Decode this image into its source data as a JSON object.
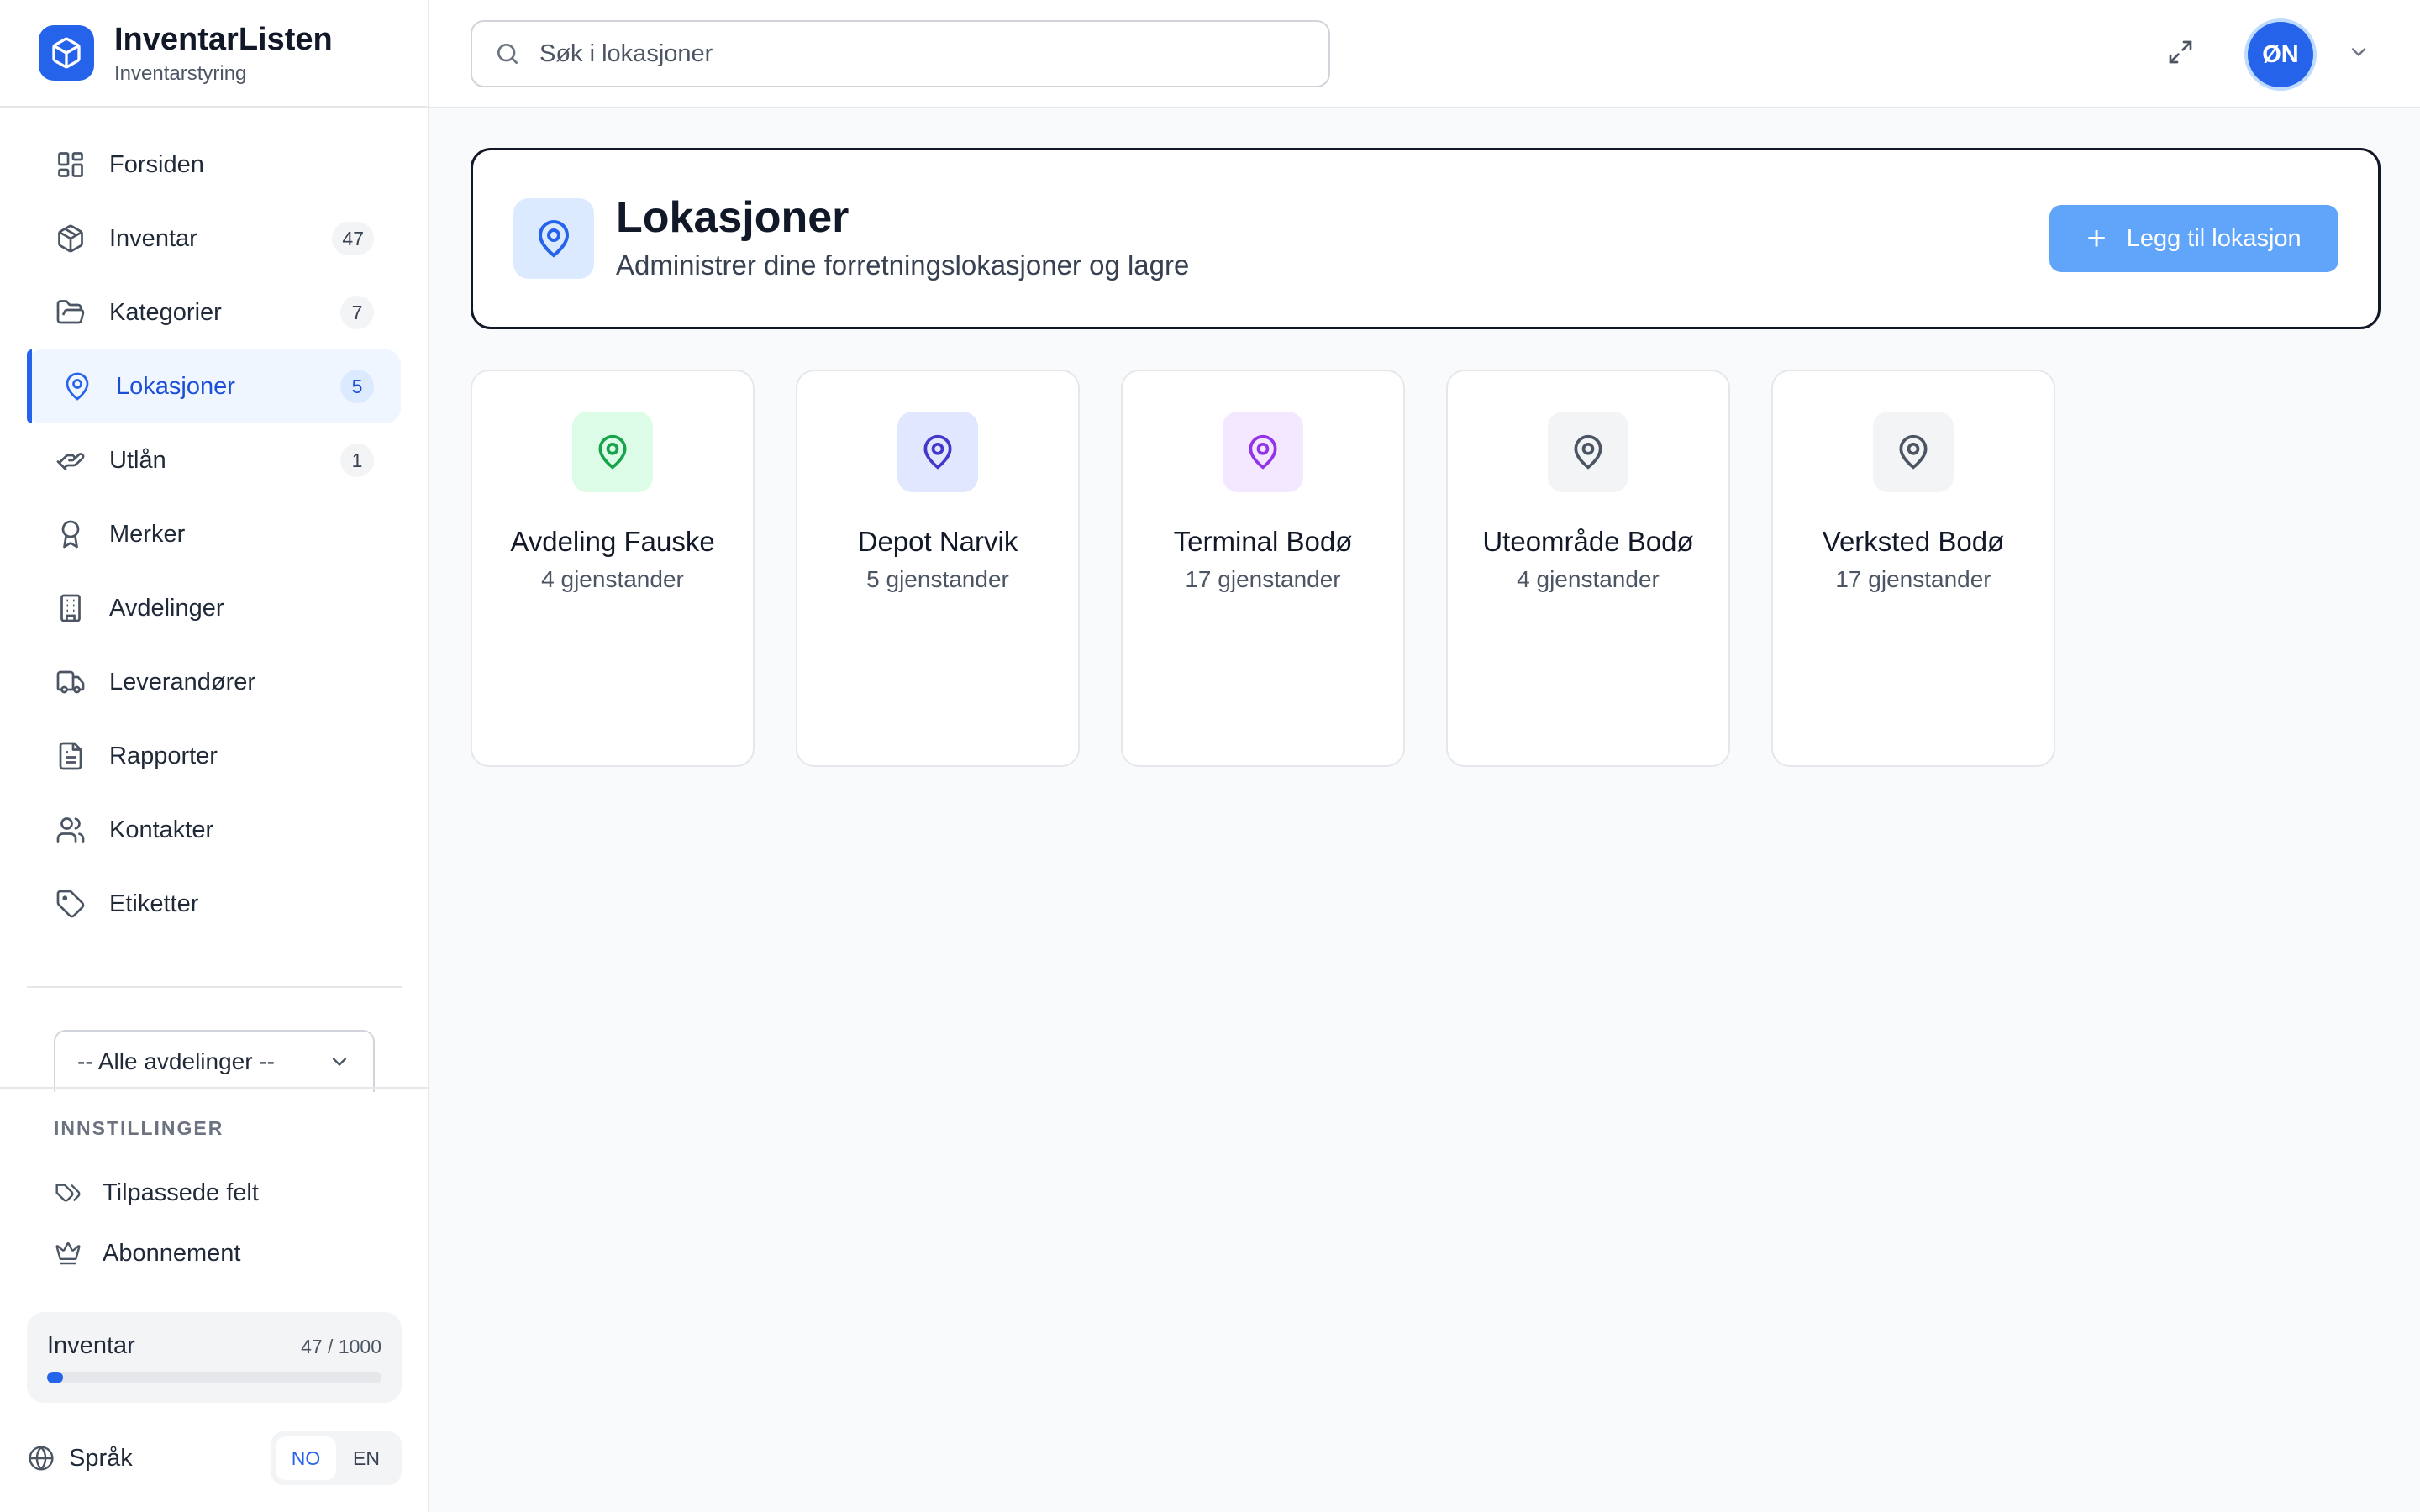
{
  "brand": {
    "name": "InventarListen",
    "subtitle": "Inventarstyring",
    "logo_icon": "cube-icon",
    "color": "#2563eb"
  },
  "nav": [
    {
      "label": "Forsiden",
      "icon": "dashboard-grid-icon",
      "badge": ""
    },
    {
      "label": "Inventar",
      "icon": "package-icon",
      "badge": "47"
    },
    {
      "label": "Kategorier",
      "icon": "folder-open-icon",
      "badge": "7"
    },
    {
      "label": "Lokasjoner",
      "icon": "map-pin-icon",
      "badge": "5",
      "active": true
    },
    {
      "label": "Utlån",
      "icon": "hand-coins-icon",
      "badge": "1"
    },
    {
      "label": "Merker",
      "icon": "award-icon",
      "badge": ""
    },
    {
      "label": "Avdelinger",
      "icon": "building-icon",
      "badge": ""
    },
    {
      "label": "Leverandører",
      "icon": "truck-icon",
      "badge": ""
    },
    {
      "label": "Rapporter",
      "icon": "file-text-icon",
      "badge": ""
    },
    {
      "label": "Kontakter",
      "icon": "users-icon",
      "badge": ""
    },
    {
      "label": "Etiketter",
      "icon": "tag-icon",
      "badge": ""
    }
  ],
  "department_filter": {
    "selected": "-- Alle avdelinger --"
  },
  "settings": {
    "title": "INNSTILLINGER",
    "items": [
      {
        "label": "Tilpassede felt",
        "icon": "tags-icon"
      },
      {
        "label": "Abonnement",
        "icon": "crown-icon"
      }
    ]
  },
  "usage": {
    "label": "Inventar",
    "count_text": "47 / 1000",
    "used": 47,
    "limit": 1000
  },
  "language": {
    "label": "Språk",
    "options": [
      "NO",
      "EN"
    ],
    "selected": "NO"
  },
  "topbar": {
    "search_placeholder": "Søk i lokasjoner",
    "search_value": "",
    "user_initials": "ØN"
  },
  "page": {
    "title": "Lokasjoner",
    "subtitle": "Administrer dine forretningslokasjoner og lagre",
    "add_button": "Legg til lokasjon",
    "add_icon": "+"
  },
  "locations": [
    {
      "name": "Avdeling Fauske",
      "count": "4 gjenstander",
      "icon_color": "#16a34a",
      "icon_bg": "#dcfce7"
    },
    {
      "name": "Depot Narvik",
      "count": "5 gjenstander",
      "icon_color": "#4338ca",
      "icon_bg": "#e0e7ff"
    },
    {
      "name": "Terminal Bodø",
      "count": "17 gjenstander",
      "icon_color": "#9333ea",
      "icon_bg": "#f3e8ff"
    },
    {
      "name": "Uteområde Bodø",
      "count": "4 gjenstander",
      "icon_color": "#4b5563",
      "icon_bg": "#f3f4f6"
    },
    {
      "name": "Verksted Bodø",
      "count": "17 gjenstander",
      "icon_color": "#4b5563",
      "icon_bg": "#f3f4f6"
    }
  ]
}
